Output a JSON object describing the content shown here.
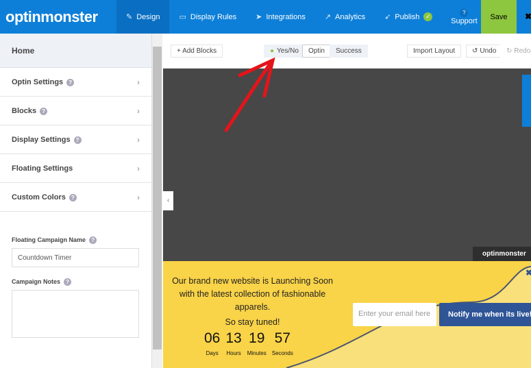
{
  "header": {
    "logo": "optinmonster",
    "nav": [
      {
        "label": "Design",
        "icon": "pencil-icon"
      },
      {
        "label": "Display Rules",
        "icon": "monitor-icon"
      },
      {
        "label": "Integrations",
        "icon": "paper-plane-icon"
      },
      {
        "label": "Analytics",
        "icon": "chart-icon"
      },
      {
        "label": "Publish",
        "icon": "rocket-icon"
      }
    ],
    "support_label": "Support",
    "save_label": "Save"
  },
  "sidebar": {
    "home": "Home",
    "items": [
      {
        "label": "Optin Settings",
        "help": true
      },
      {
        "label": "Blocks",
        "help": true
      },
      {
        "label": "Display Settings",
        "help": true
      },
      {
        "label": "Floating Settings",
        "help": false
      },
      {
        "label": "Custom Colors",
        "help": true
      }
    ],
    "campaign_name_label": "Floating Campaign Name",
    "campaign_name_value": "Countdown Timer",
    "notes_label": "Campaign Notes",
    "notes_value": ""
  },
  "toolbar": {
    "add_blocks": "+ Add Blocks",
    "views": [
      "Yes/No",
      "Optin",
      "Success"
    ],
    "active_view": "Optin",
    "import_layout": "Import Layout",
    "undo": "Undo",
    "redo": "Redo"
  },
  "preview": {
    "brand_tag": "optinmonster",
    "message_line1": "Our brand new website is Launching Soon with the latest collection of fashionable apparels.",
    "message_line2": "So stay tuned!",
    "countdown": [
      {
        "value": "06",
        "unit": "Days"
      },
      {
        "value": "13",
        "unit": "Hours"
      },
      {
        "value": "19",
        "unit": "Minutes"
      },
      {
        "value": "57",
        "unit": "Seconds"
      }
    ],
    "email_placeholder": "Enter your email here",
    "button": "Notify me when its live!"
  },
  "colors": {
    "brand": "#0d7fd8",
    "save": "#8dc63f",
    "banner": "#f9d348",
    "button": "#2f5597"
  }
}
